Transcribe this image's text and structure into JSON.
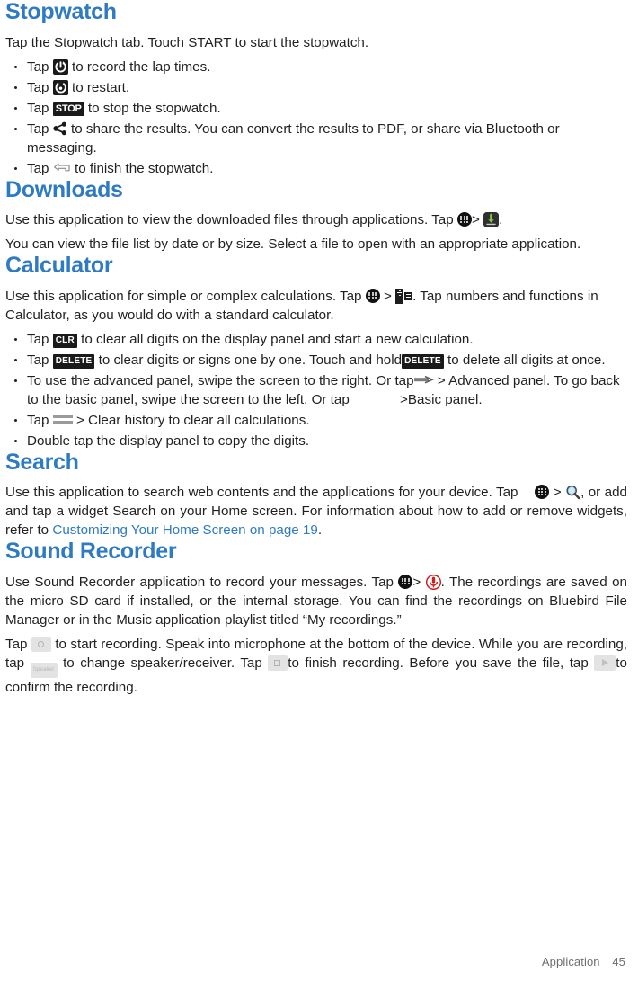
{
  "sections": [
    {
      "id": "stopwatch",
      "title": "Stopwatch",
      "intro": "Tap the Stopwatch tab. Touch START to start the stopwatch.",
      "bullets": [
        {
          "pre": "Tap",
          "icon": "lap-icon",
          "post": "to record the lap  times."
        },
        {
          "pre": "Tap",
          "icon": "restart-icon",
          "post": "to restart."
        },
        {
          "pre": "Tap",
          "icon": "stop-chip",
          "chip": "STOP",
          "post": "to stop the stopwatch."
        },
        {
          "pre": "Tap",
          "icon": "share-icon",
          "post": "to share the results. You can convert the results to PDF, or share   via Bluetooth or messaging."
        },
        {
          "pre": "Tap",
          "icon": "back-icon",
          "post": "to finish the stopwatch."
        }
      ]
    },
    {
      "id": "downloads",
      "title": "Downloads",
      "para_1a": "Use this application to view the downloaded files through applications.",
      "para_1b": "Tap",
      "para_1c": ">",
      "para_1d": ".",
      "para_2": "You can view the file list by date or by size. Select a file to open with an appropriate application."
    },
    {
      "id": "calculator",
      "title": "Calculator",
      "para_1a": "Use this application for simple or complex calculations.",
      "para_1b": "Tap",
      "para_1c": ">",
      "para_1d": ". Tap numbers and functions in Calculator, as you would do with a standard  calculator.",
      "bullets": [
        {
          "pre": "Tap",
          "chip": "CLR",
          "post": "to clear all digits on the display panel and start a new   calculation."
        },
        {
          "pre": "Tap",
          "chip": "DELETE",
          "mid": "to clear digits or signs one by one. Touch   and hold",
          "chip2": "DELETE",
          "post": "to delete all digits at once."
        },
        {
          "pre": "To use the advanced panel, swipe the screen to the right. Or tap",
          "icon": "arrow-bar-icon",
          "mid": "> Advanced panel. To go back to the basic panel, swipe the screen to the left. Or tap",
          "post": ">Basic   panel."
        },
        {
          "pre": "Tap",
          "icon": "menu-icon",
          "post": "> Clear history to clear all calculations."
        },
        {
          "pre": "Double tap the display panel to copy the digits."
        }
      ]
    },
    {
      "id": "search",
      "title": "Search",
      "para_a": "Use this application to search web contents and the applications for your device.",
      "para_b": "Tap",
      "para_c": ">",
      "para_d": ", or add and tap a widget Search on your Home screen. For information about how to add or remove widgets, refer to",
      "link": "Customizing Your Home Screen on page  19",
      "para_e": "."
    },
    {
      "id": "sound-recorder",
      "title": "Sound Recorder",
      "para_a": "Use Sound Recorder application to record your messages.",
      "para_b": "Tap",
      "para_c": ">",
      "para_d": ". The recordings are saved on the micro SD card if installed, or the internal storage. You can find the recordings on Bluebird File Manager or in the Music application playlist titled “My   recordings.”",
      "para_e": "Tap",
      "para_f": "to start recording. Speak into microphone at the bottom of the device. While you are recording, tap",
      "para_g": "to change speaker/receiver. Tap",
      "para_h": "to finish recording. Before you save the file, tap",
      "para_i": "to confirm the  recording.",
      "speaker_button_label": "Speaker"
    }
  ],
  "footer": {
    "label": "Application",
    "page_number": "45"
  },
  "colors": {
    "heading": "#2e7bc4",
    "link": "#2e7bc4",
    "body": "#231f20",
    "footer": "#6d6e71",
    "chip_bg": "#1a1a1a",
    "download_green": "#7ab648",
    "mic_red": "#d01c1f"
  }
}
